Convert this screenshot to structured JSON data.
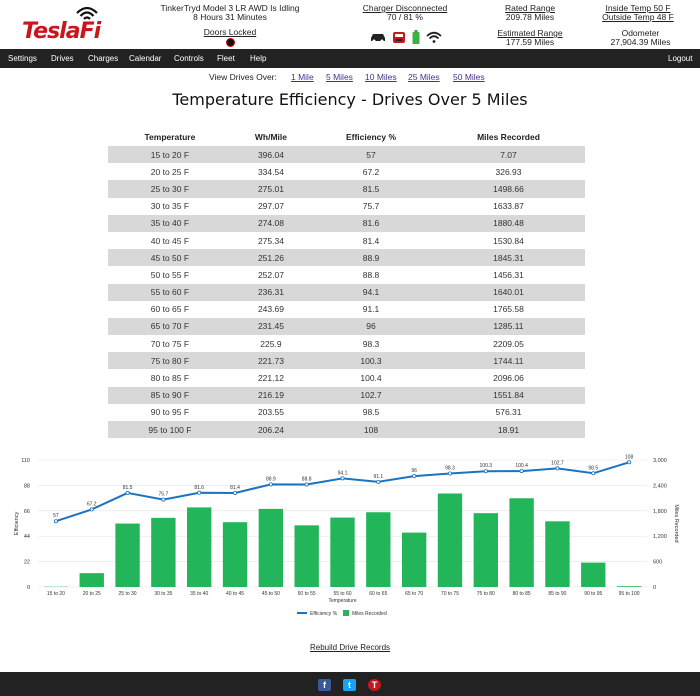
{
  "header": {
    "logo_text": "TeslaFi",
    "vehicle_status": "TinkerTryd Model 3 LR AWD Is Idling",
    "idle_duration": "8 Hours 31 Minutes",
    "doors": "Doors Locked",
    "charger_status": "Charger Disconnected",
    "charge_level": "70 / 81 %",
    "rated_range_label": "Rated Range",
    "rated_range": "209.78 Miles",
    "estimated_range_label": "Estimated Range",
    "estimated_range": "177.59 Miles",
    "inside_temp": "Inside Temp 50 F",
    "outside_temp": "Outside Temp 48 F",
    "odometer_label": "Odometer",
    "odometer": "27,904.39 Miles",
    "status_icons": [
      "car-icon",
      "charger-icon",
      "battery-icon",
      "wifi-icon"
    ]
  },
  "nav": {
    "items": [
      "Settings",
      "Drives",
      "Charges",
      "Calendar",
      "Controls",
      "Fleet",
      "Help"
    ],
    "logout": "Logout"
  },
  "filter": {
    "label": "View Drives Over:",
    "options": [
      "1 Mile",
      "5 Miles",
      "10 Miles",
      "25 Miles",
      "50 Miles"
    ]
  },
  "title": "Temperature Efficiency - Drives Over 5 Miles",
  "table": {
    "headers": [
      "Temperature",
      "Wh/Mile",
      "Efficiency %",
      "Miles Recorded"
    ],
    "rows": [
      [
        "15 to 20 F",
        "396.04",
        "57",
        "7.07"
      ],
      [
        "20 to 25 F",
        "334.54",
        "67.2",
        "326.93"
      ],
      [
        "25 to 30 F",
        "275.01",
        "81.5",
        "1498.66"
      ],
      [
        "30 to 35 F",
        "297.07",
        "75.7",
        "1633.87"
      ],
      [
        "35 to 40 F",
        "274.08",
        "81.6",
        "1880.48"
      ],
      [
        "40 to 45 F",
        "275.34",
        "81.4",
        "1530.84"
      ],
      [
        "45 to 50 F",
        "251.26",
        "88.9",
        "1845.31"
      ],
      [
        "50 to 55 F",
        "252.07",
        "88.8",
        "1456.31"
      ],
      [
        "55 to 60 F",
        "236.31",
        "94.1",
        "1640.01"
      ],
      [
        "60 to 65 F",
        "243.69",
        "91.1",
        "1765.58"
      ],
      [
        "65 to 70 F",
        "231.45",
        "96",
        "1285.11"
      ],
      [
        "70 to 75 F",
        "225.9",
        "98.3",
        "2209.05"
      ],
      [
        "75 to 80 F",
        "221.73",
        "100.3",
        "1744.11"
      ],
      [
        "80 to 85 F",
        "221.12",
        "100.4",
        "2096.06"
      ],
      [
        "85 to 90 F",
        "216.19",
        "102.7",
        "1551.84"
      ],
      [
        "90 to 95 F",
        "203.55",
        "98.5",
        "576.31"
      ],
      [
        "95 to 100 F",
        "206.24",
        "108",
        "18.91"
      ]
    ]
  },
  "chart_data": {
    "type": "bar",
    "categories": [
      "15 to 20",
      "20 to 25",
      "25 to 30",
      "30 to 35",
      "35 to 40",
      "40 to 45",
      "45 to 50",
      "50 to 55",
      "55 to 60",
      "60 to 65",
      "65 to 70",
      "70 to 75",
      "75 to 80",
      "80 to 85",
      "85 to 90",
      "90 to 95",
      "95 to 100"
    ],
    "series": [
      {
        "name": "Efficiency %",
        "type": "line",
        "axis": "left",
        "color": "#1a73c2",
        "values": [
          57,
          67.2,
          81.5,
          75.7,
          81.6,
          81.4,
          88.9,
          88.8,
          94.1,
          91.1,
          96,
          98.3,
          100.3,
          100.4,
          102.7,
          98.5,
          108
        ]
      },
      {
        "name": "Miles Recorded",
        "type": "bar",
        "axis": "right",
        "color": "#22b55a",
        "values": [
          7.07,
          326.93,
          1498.66,
          1633.87,
          1880.48,
          1530.84,
          1845.31,
          1456.31,
          1640.01,
          1765.58,
          1285.11,
          2209.05,
          1744.11,
          2096.06,
          1551.84,
          576.31,
          18.91
        ]
      }
    ],
    "data_labels": [
      "57",
      "67.2",
      "81.5",
      "75.7",
      "81.6",
      "81.4",
      "88.9",
      "88.8",
      "94.1",
      "91.1",
      "96",
      "98.3",
      "100.3",
      "100.4",
      "102.7",
      "98.5",
      "108"
    ],
    "xlabel": "Temperature",
    "ylabel_left": "Efficiency",
    "ylabel_right": "Miles Recorded",
    "ylim_left": [
      0,
      110
    ],
    "yticks_left": [
      "0",
      "22",
      "44",
      "66",
      "88",
      "110"
    ],
    "ylim_right": [
      0,
      3000
    ],
    "yticks_right": [
      "0",
      "600",
      "1,200",
      "1,800",
      "2,400",
      "3,000"
    ],
    "grid": true,
    "legend": "bottom-center"
  },
  "rebuild_link": "Rebuild Drive Records",
  "footer": {
    "icons": [
      "facebook-icon",
      "twitter-icon",
      "teslafi-icon"
    ],
    "facebook": "f",
    "twitter": "t",
    "teslafi": "T"
  }
}
